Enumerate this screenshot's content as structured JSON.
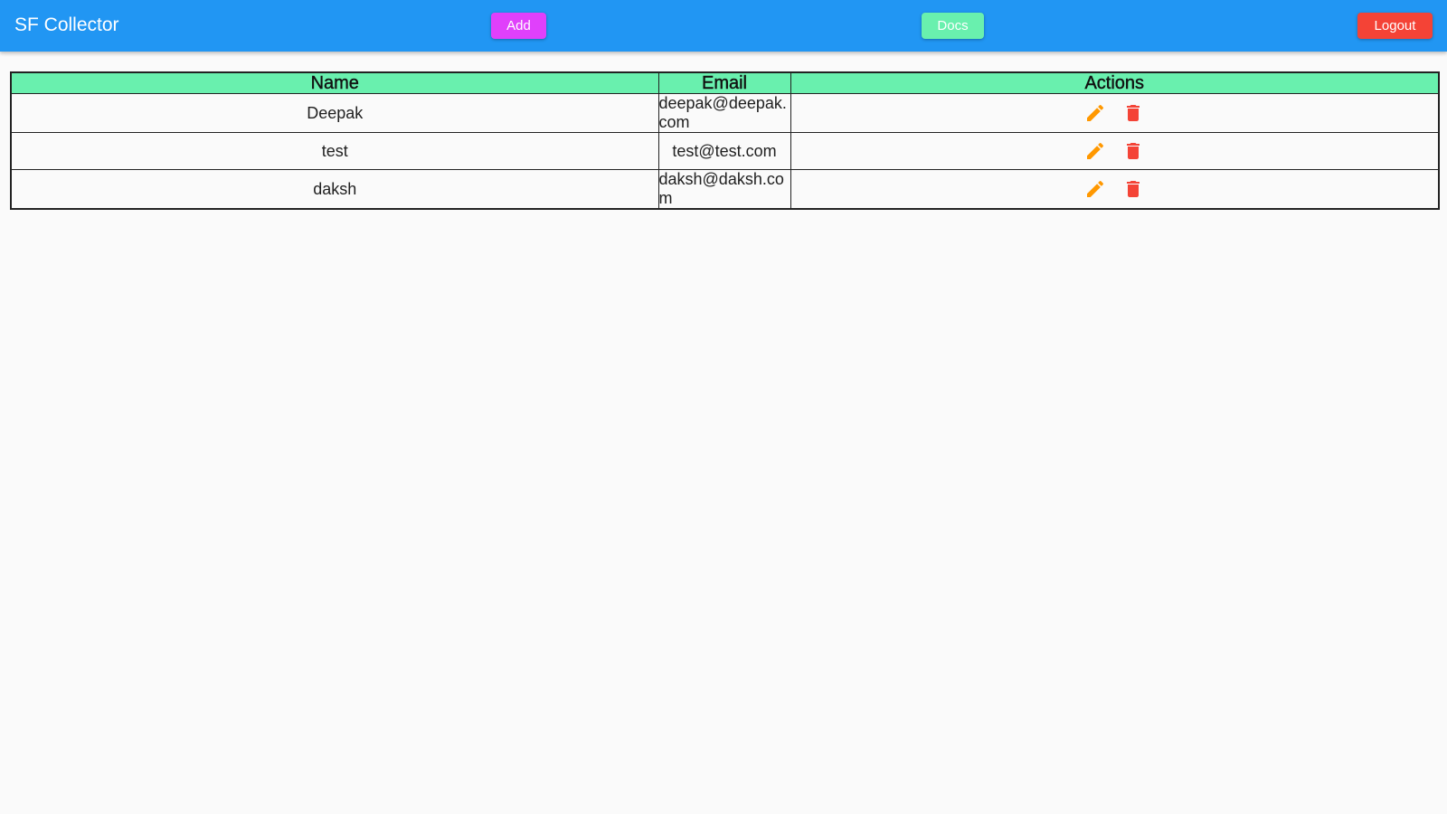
{
  "appbar": {
    "title": "SF Collector",
    "background": "#2196f3",
    "add_label": "Add",
    "docs_label": "Docs",
    "logout_label": "Logout"
  },
  "table": {
    "headers": {
      "name": "Name",
      "email": "Email",
      "actions": "Actions"
    },
    "header_color": "#69f0ae",
    "rows": [
      {
        "name": "Deepak",
        "email": "deepak@deepak.com",
        "actions": [
          "edit-icon",
          "delete-icon"
        ]
      },
      {
        "name": "test",
        "email": "test@test.com",
        "actions": [
          "edit-icon",
          "delete-icon"
        ]
      },
      {
        "name": "daksh",
        "email": "daksh@daksh.com",
        "actions": [
          "edit-icon",
          "delete-icon"
        ]
      }
    ]
  },
  "colors": {
    "add_button": "#e040fb",
    "docs_button": "#69f0ae",
    "logout_button": "#f44336",
    "edit_icon": "#ff9800",
    "delete_icon": "#f44336"
  }
}
